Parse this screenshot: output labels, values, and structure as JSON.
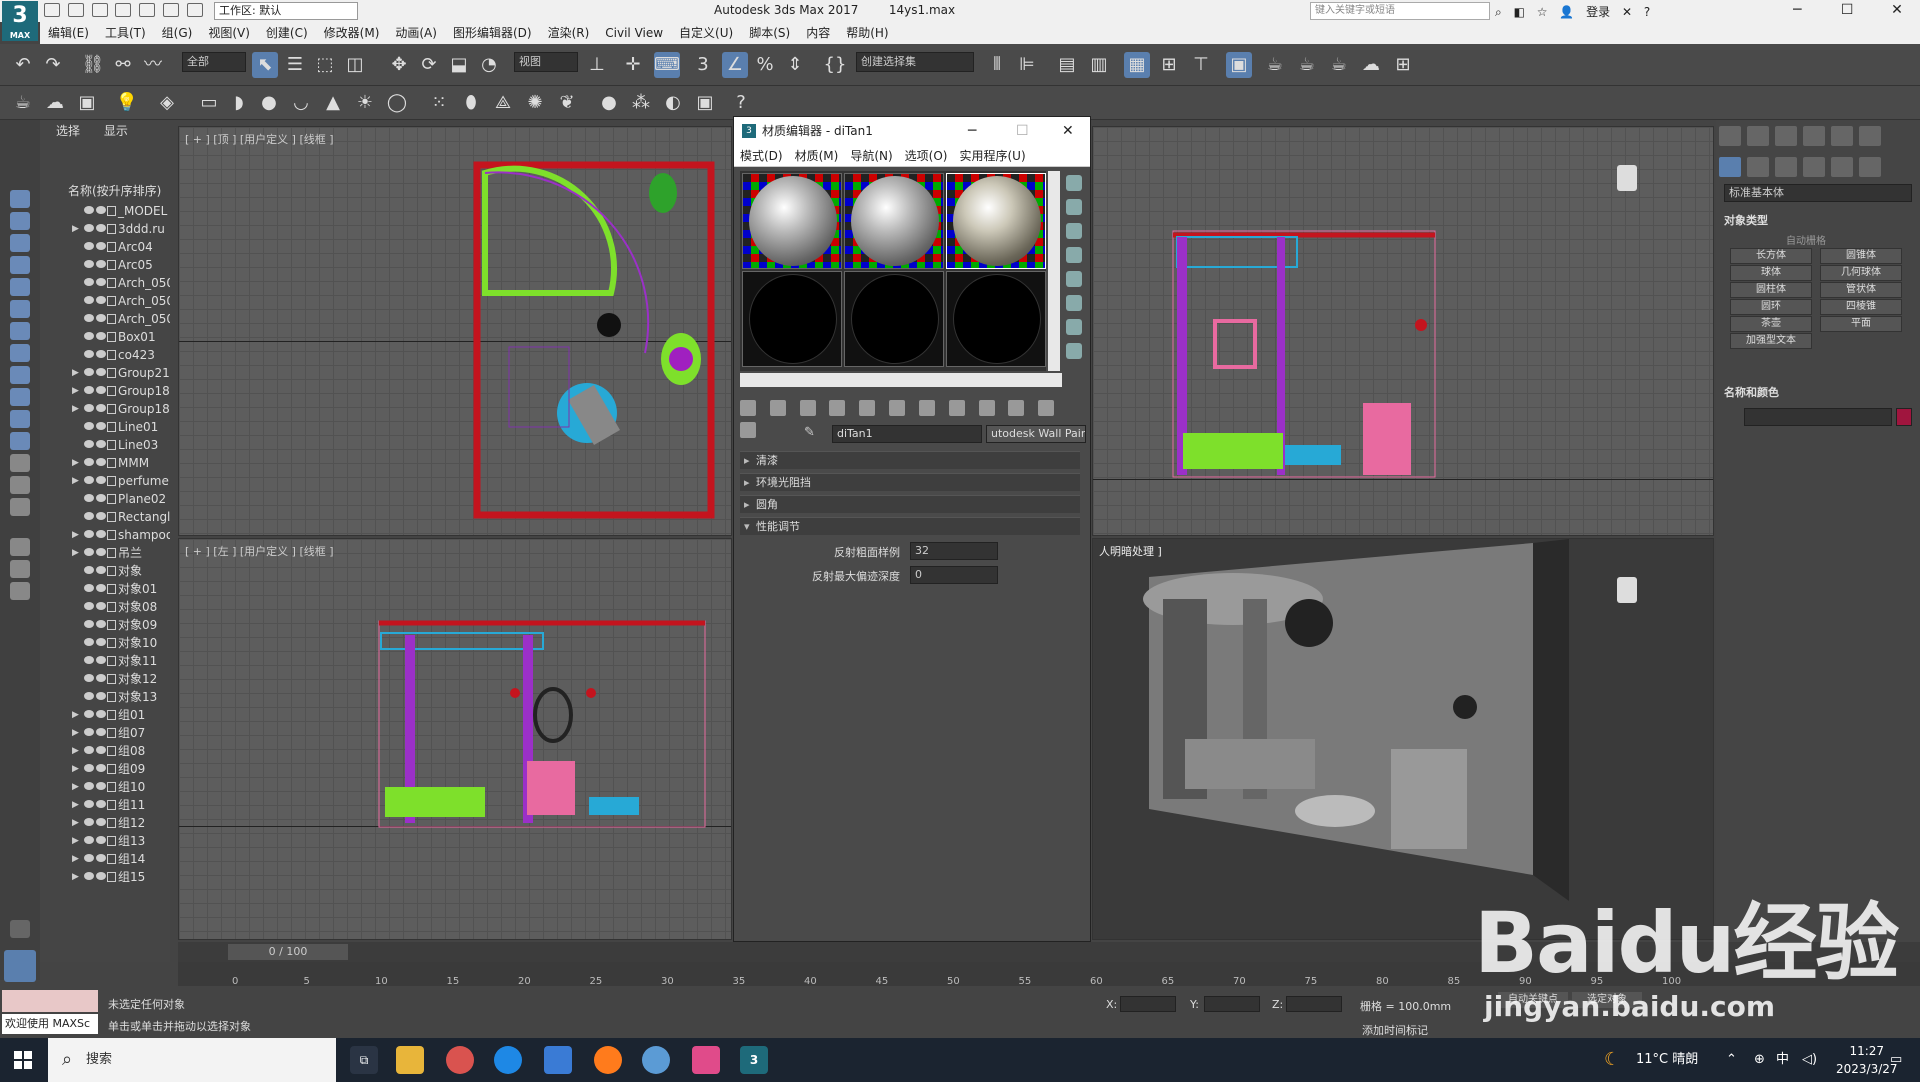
{
  "titlebar": {
    "workspace": "工作区: 默认",
    "app_title": "Autodesk 3ds Max 2017",
    "file_name": "14ys1.max",
    "search_placeholder": "键入关键字或短语",
    "login": "登录",
    "logo_text": "3",
    "logo_sub": "MAX"
  },
  "menu": [
    "编辑(E)",
    "工具(T)",
    "组(G)",
    "视图(V)",
    "创建(C)",
    "修改器(M)",
    "动画(A)",
    "图形编辑器(D)",
    "渲染(R)",
    "Civil View",
    "自定义(U)",
    "脚本(S)",
    "内容",
    "帮助(H)"
  ],
  "toolbar": {
    "filter_dropdown": "全部",
    "view_dropdown": "视图",
    "selection_set": "创建选择集"
  },
  "explorer": {
    "tabs": [
      "选择",
      "显示"
    ],
    "header": "名称(按升序排序)",
    "items": [
      {
        "name": "_MODEL",
        "expand": false
      },
      {
        "name": "3ddd.ru",
        "expand": true
      },
      {
        "name": "Arc04",
        "expand": false
      },
      {
        "name": "Arc05",
        "expand": false
      },
      {
        "name": "Arch_050",
        "expand": false
      },
      {
        "name": "Arch_050",
        "expand": false
      },
      {
        "name": "Arch_050",
        "expand": false
      },
      {
        "name": "Box01",
        "expand": false
      },
      {
        "name": "co423",
        "expand": false
      },
      {
        "name": "Group21",
        "expand": true
      },
      {
        "name": "Group18",
        "expand": true
      },
      {
        "name": "Group18",
        "expand": true
      },
      {
        "name": "Line01",
        "expand": false
      },
      {
        "name": "Line03",
        "expand": false
      },
      {
        "name": "MMM",
        "expand": true
      },
      {
        "name": "perfume",
        "expand": true
      },
      {
        "name": "Plane02",
        "expand": false
      },
      {
        "name": "Rectangl",
        "expand": false
      },
      {
        "name": "shampoo",
        "expand": true
      },
      {
        "name": "吊兰",
        "expand": true
      },
      {
        "name": "对象",
        "expand": false
      },
      {
        "name": "对象01",
        "expand": false
      },
      {
        "name": "对象08",
        "expand": false
      },
      {
        "name": "对象09",
        "expand": false
      },
      {
        "name": "对象10",
        "expand": false
      },
      {
        "name": "对象11",
        "expand": false
      },
      {
        "name": "对象12",
        "expand": false
      },
      {
        "name": "对象13",
        "expand": false
      },
      {
        "name": "组01",
        "expand": true
      },
      {
        "name": "组07",
        "expand": true
      },
      {
        "name": "组08",
        "expand": true
      },
      {
        "name": "组09",
        "expand": true
      },
      {
        "name": "组10",
        "expand": true
      },
      {
        "name": "组11",
        "expand": true
      },
      {
        "name": "组12",
        "expand": true
      },
      {
        "name": "组13",
        "expand": true
      },
      {
        "name": "组14",
        "expand": true
      },
      {
        "name": "组15",
        "expand": true
      }
    ]
  },
  "viewports": {
    "top_label": "[ + ] [顶 ] [用户定义 ] [线框 ]",
    "left_label": "[ + ] [左 ] [用户定义 ] [线框 ]",
    "persp_label": "人明暗处理 ]"
  },
  "material_editor": {
    "title": "材质编辑器 - diTan1",
    "menu": [
      "模式(D)",
      "材质(M)",
      "导航(N)",
      "选项(O)",
      "实用程序(U)"
    ],
    "material_name": "diTan1",
    "material_type": "utodesk Wall Pain",
    "rollouts": [
      "清漆",
      "环境光阻挡",
      "圆角",
      "性能调节"
    ],
    "params": [
      {
        "label": "反射粗面样例",
        "value": "32"
      },
      {
        "label": "反射最大偏迹深度",
        "value": "0"
      }
    ]
  },
  "command_panel": {
    "dropdown": "标准基本体",
    "object_type_title": "对象类型",
    "autogrid": "自动栅格",
    "buttons": [
      "长方体",
      "圆锥体",
      "球体",
      "几何球体",
      "圆柱体",
      "管状体",
      "圆环",
      "四棱锥",
      "茶壶",
      "平面",
      "加强型文本"
    ],
    "name_color_title": "名称和颜色"
  },
  "timeline": {
    "frame": "0 / 100",
    "ticks": [
      "0",
      "5",
      "10",
      "15",
      "20",
      "25",
      "30",
      "35",
      "40",
      "45",
      "50",
      "55",
      "60",
      "65",
      "70",
      "75",
      "80",
      "85",
      "90",
      "95",
      "100"
    ]
  },
  "status": {
    "welcome": "欢迎使用 MAXSc",
    "line1": "未选定任何对象",
    "line2": "单击或单击并拖动以选择对象",
    "x_label": "X:",
    "y_label": "Y:",
    "z_label": "Z:",
    "grid": "栅格 = 100.0mm",
    "add_tag": "添加时间标记",
    "auto_key": "自动关键点",
    "set_key": "选定对象"
  },
  "taskbar": {
    "search": "搜索",
    "weather": "11°C 晴朗",
    "ime": "中",
    "time": "11:27",
    "date": "2023/3/27"
  },
  "watermark": {
    "logo": "Baidu经验",
    "url": "jingyan.baidu.com"
  },
  "colors": {
    "accent": "#5a7fae",
    "viewport_bg": "#5d5d5d",
    "wall_red": "#c4141e"
  }
}
